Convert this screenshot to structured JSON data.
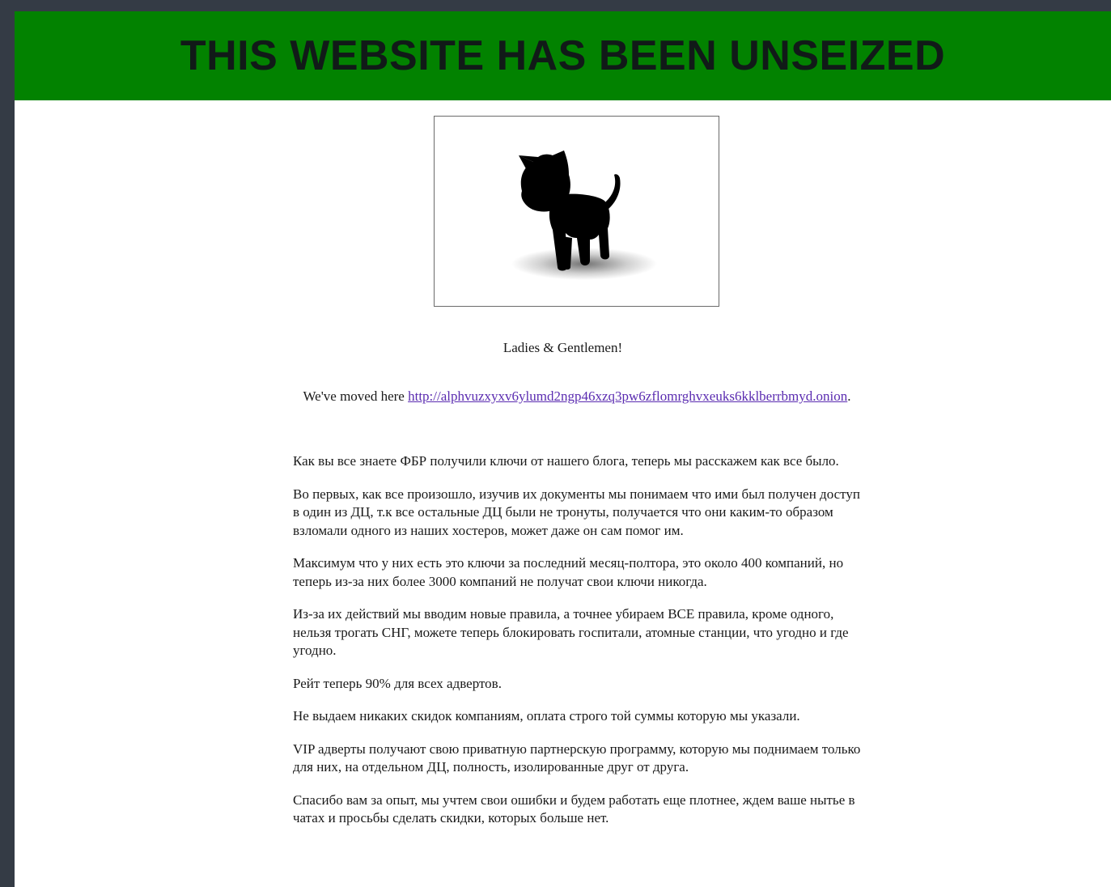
{
  "banner": {
    "title": "THIS WEBSITE HAS BEEN UNSEIZED",
    "background": "#028200"
  },
  "image": {
    "icon": "black-kitten-silhouette-icon"
  },
  "greeting": "Ladies & Gentlemen!",
  "moved": {
    "prefix": "We've moved here ",
    "link": "http://alphvuzxyxv6ylumd2ngp46xzq3pw6zflomrghvxeuks6kklberrbmyd.onion",
    "suffix": "."
  },
  "paragraphs": [
    "Как вы все знаете ФБР получили ключи от нашего блога, теперь мы расскажем как все было.",
    "Во первых, как все произошло, изучив их документы мы понимаем что ими был получен доступ в один из ДЦ, т.к все остальные ДЦ были не тронуты, получается что они каким-то образом взломали одного из наших хостеров, может даже он сам помог им.",
    "Максимум что у них есть это ключи за последний месяц-полтора, это около 400 компаний, но теперь из-за них более 3000 компаний не получат свои ключи никогда.",
    "Из-за их действий мы вводим новые правила, а точнее убираем ВСЕ правила, кроме одного, нельзя трогать СНГ, можете теперь блокировать госпитали, атомные станции, что угодно и где угодно.",
    "Рейт теперь 90% для всех адвертов.",
    "Не выдаем никаких скидок компаниям, оплата строго той суммы которую мы указали.",
    "VIP адверты получают свою приватную партнерскую программу, которую мы поднимаем только для них, на отдельном ДЦ, полность, изолированные друг от друга.",
    "Спасибо вам за опыт, мы учтем свои ошибки и будем работать еще плотнее, ждем ваше нытье в чатах и просьбы сделать скидки, которых больше нет."
  ]
}
